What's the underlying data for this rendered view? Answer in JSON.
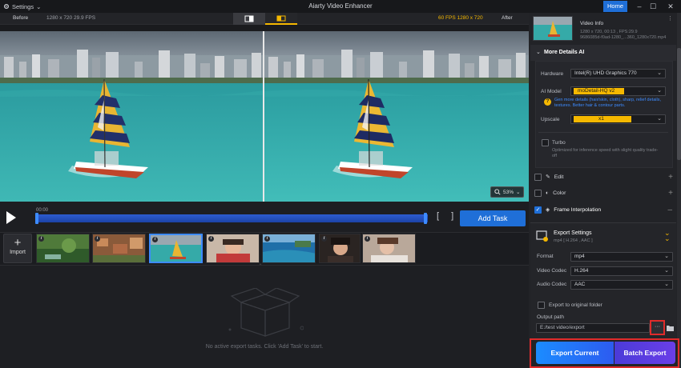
{
  "window": {
    "title": "Aiarty Video Enhancer",
    "settings_label": "Settings",
    "home_label": "Home"
  },
  "compare": {
    "before_label": "Before",
    "before_info": "1280 x 720  29.9 FPS",
    "after_info": "60 FPS  1280 x 720",
    "after_label": "After"
  },
  "player": {
    "time": "00:00",
    "zoom": "53%",
    "add_task": "Add Task"
  },
  "import_label": "Import",
  "no_tasks": "No active export tasks. Click 'Add Task' to start.",
  "video_info": {
    "title": "Video Info",
    "line1": "1280 x 720, 00:13 ,  FPS:29.9",
    "line2": "9686085d-f0ad-1280_...360_1280x720.mp4"
  },
  "details": {
    "header": "More Details AI",
    "hardware_label": "Hardware",
    "hardware_value": "Intel(R) UHD Graphics 770",
    "model_label": "AI Model",
    "model_value": "moDetail-HQ  v2",
    "model_desc": "Gen more details (hair/skin, cloth), sharp, relief details, textures. Better hair & contour parts.",
    "upscale_label": "Upscale",
    "upscale_value": "x1",
    "turbo_label": "Turbo",
    "turbo_desc": "Optimized for inference speed with slight quality trade-off"
  },
  "sections": {
    "edit": "Edit",
    "color": "Color",
    "interp": "Frame Interpolation"
  },
  "export": {
    "title": "Export Settings",
    "subtitle": "mp4 [ H.264 , AAC ]",
    "format_label": "Format",
    "format_value": "mp4",
    "vcodec_label": "Video Codec",
    "vcodec_value": "H.264",
    "acodec_label": "Audio Codec",
    "acodec_value": "AAC",
    "original_folder": "Export to original folder",
    "output_label": "Output path",
    "output_value": "E:/test video/export",
    "browse": "···",
    "export_current": "Export Current",
    "batch_export": "Batch Export"
  },
  "colors": {
    "accent": "#1f6fd8",
    "highlight": "#f5b800",
    "alert": "#e02b2b"
  }
}
